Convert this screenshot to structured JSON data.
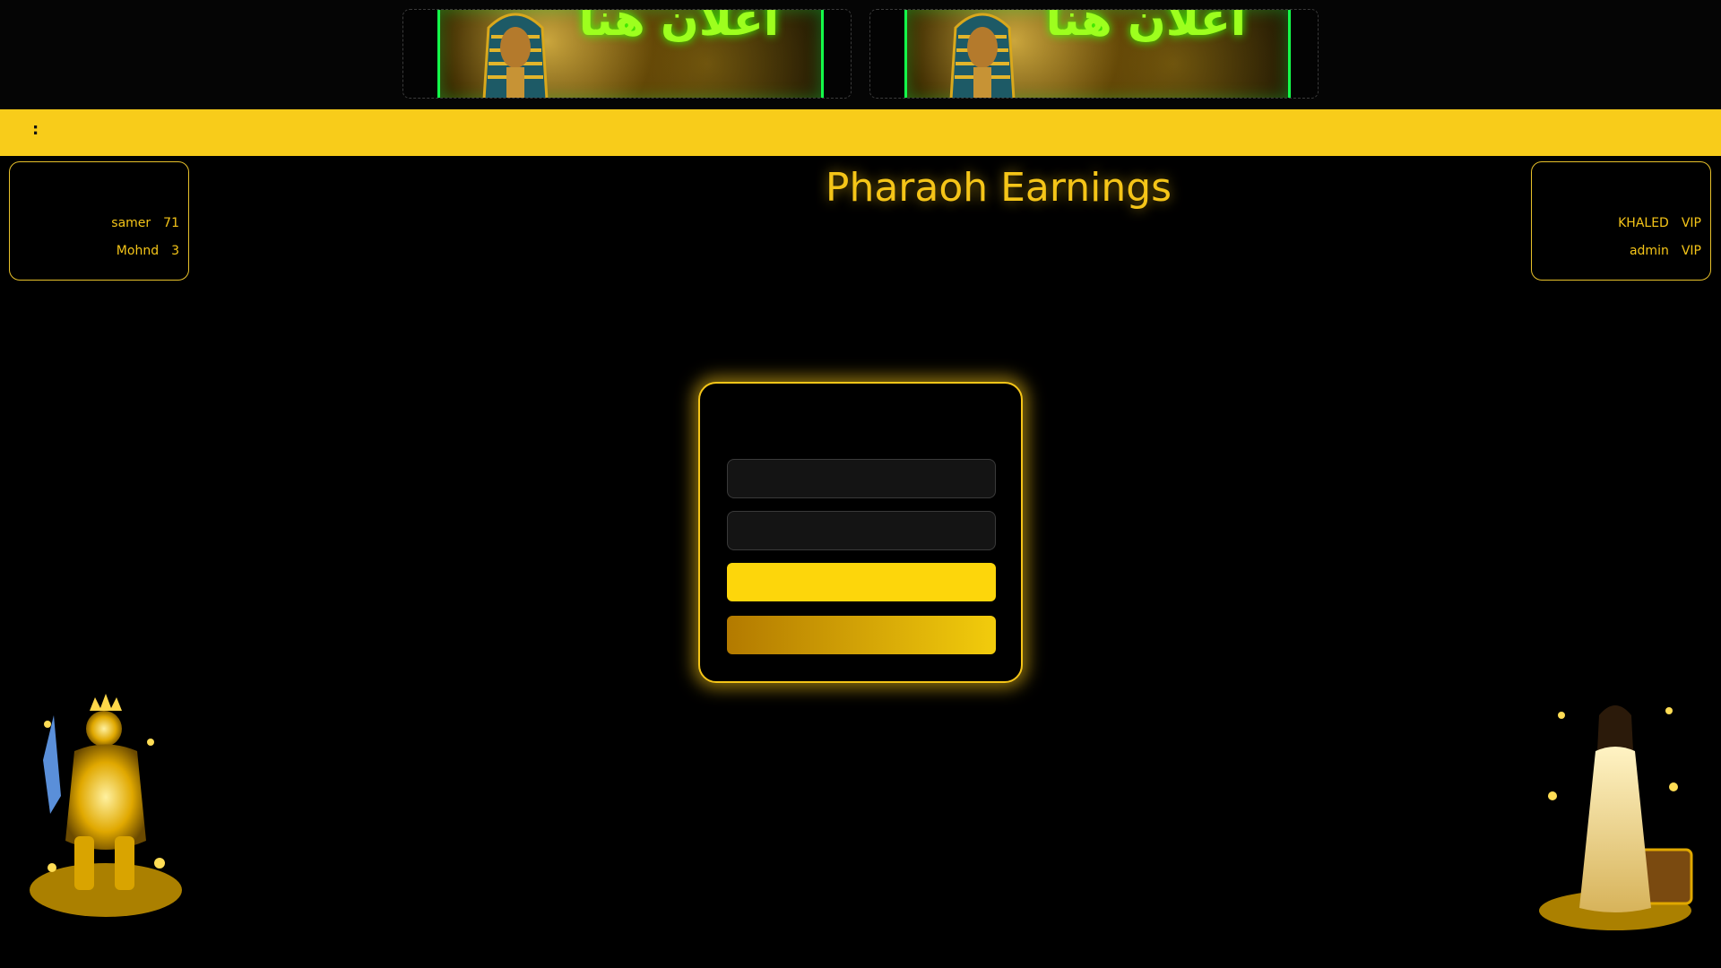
{
  "banners": [
    {
      "text": "اعلان هنا"
    },
    {
      "text": "اعلان هنا"
    }
  ],
  "ticker": {
    "text": ":"
  },
  "site_title": "Pharaoh Earnings",
  "left_ranking": {
    "rows": [
      {
        "name": "samer",
        "value": "71"
      },
      {
        "name": "Mohnd",
        "value": "3"
      }
    ]
  },
  "right_ranking": {
    "rows": [
      {
        "name": "KHALED",
        "value": "VIP"
      },
      {
        "name": "admin",
        "value": "VIP"
      }
    ]
  },
  "login": {
    "username_value": "",
    "password_value": "",
    "login_label": "",
    "register_label": ""
  },
  "colors": {
    "accent": "#f5c518",
    "ticker_bg": "#f8cc1a",
    "banner_green": "#14ff4a"
  },
  "icons": [
    "pharaoh-banner-image",
    "golden-king-figure",
    "egyptian-queen-figure"
  ]
}
